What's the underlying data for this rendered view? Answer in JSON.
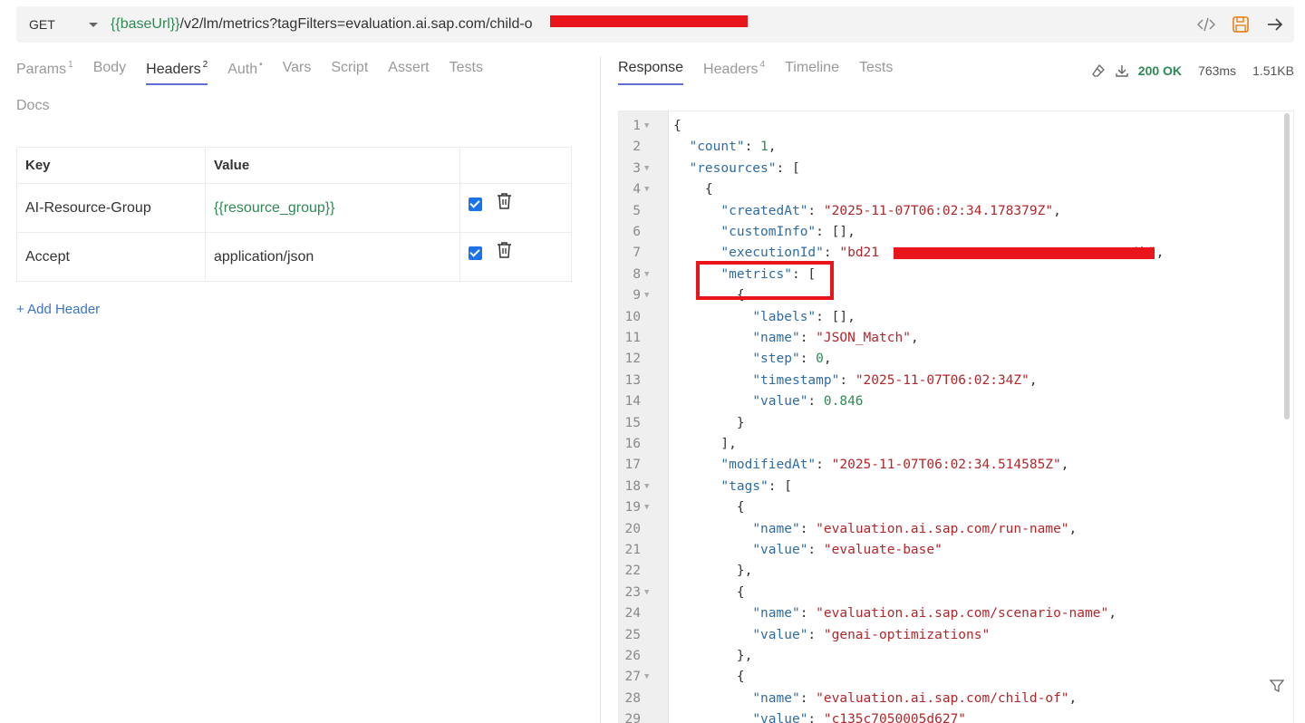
{
  "url_bar": {
    "method": "GET",
    "url_var": "{{baseUrl}}",
    "url_rest": "/v2/lm/metrics?tagFilters=evaluation.ai.sap.com/child-o"
  },
  "request_tabs": [
    {
      "label": "Params",
      "count": "1"
    },
    {
      "label": "Body",
      "count": ""
    },
    {
      "label": "Headers",
      "count": "2"
    },
    {
      "label": "Auth",
      "count": "•"
    },
    {
      "label": "Vars",
      "count": ""
    },
    {
      "label": "Script",
      "count": ""
    },
    {
      "label": "Assert",
      "count": ""
    },
    {
      "label": "Tests",
      "count": ""
    }
  ],
  "docs_tab": "Docs",
  "headers_table": {
    "col_key": "Key",
    "col_value": "Value",
    "rows": [
      {
        "key": "AI-Resource-Group",
        "value": "{{resource_group}}"
      },
      {
        "key": "Accept",
        "value": "application/json"
      }
    ],
    "add_label": "+ Add Header"
  },
  "response_tabs": [
    {
      "label": "Response",
      "count": ""
    },
    {
      "label": "Headers",
      "count": "4"
    },
    {
      "label": "Timeline",
      "count": ""
    },
    {
      "label": "Tests",
      "count": ""
    }
  ],
  "response_meta": {
    "status": "200 OK",
    "time": "763ms",
    "size": "1.51KB"
  },
  "code_lines": [
    {
      "n": "1",
      "fold": true,
      "html": "<span class='p'>{</span>"
    },
    {
      "n": "2",
      "fold": false,
      "html": "  <span class='k'>\"count\"</span><span class='p'>: </span><span class='n'>1</span><span class='p'>,</span>"
    },
    {
      "n": "3",
      "fold": true,
      "html": "  <span class='k'>\"resources\"</span><span class='p'>: [</span>"
    },
    {
      "n": "4",
      "fold": true,
      "html": "    <span class='p'>{</span>"
    },
    {
      "n": "5",
      "fold": false,
      "html": "      <span class='k'>\"createdAt\"</span><span class='p'>: </span><span class='s'>\"2025-11-07T06:02:34.178379Z\"</span><span class='p'>,</span>"
    },
    {
      "n": "6",
      "fold": false,
      "html": "      <span class='k'>\"customInfo\"</span><span class='p'>: [],</span>"
    },
    {
      "n": "7",
      "fold": false,
      "html": "      <span class='k'>\"executionId\"</span><span class='p'>: </span><span class='s'>\"bd21                                0b\"</span><span class='p'>,</span>"
    },
    {
      "n": "8",
      "fold": true,
      "html": "      <span class='k'>\"metrics\"</span><span class='p'>: [</span>"
    },
    {
      "n": "9",
      "fold": true,
      "html": "        <span class='p'>{</span>"
    },
    {
      "n": "10",
      "fold": false,
      "html": "          <span class='k'>\"labels\"</span><span class='p'>: [],</span>"
    },
    {
      "n": "11",
      "fold": false,
      "html": "          <span class='k'>\"name\"</span><span class='p'>: </span><span class='s'>\"JSON_Match\"</span><span class='p'>,</span>"
    },
    {
      "n": "12",
      "fold": false,
      "html": "          <span class='k'>\"step\"</span><span class='p'>: </span><span class='n'>0</span><span class='p'>,</span>"
    },
    {
      "n": "13",
      "fold": false,
      "html": "          <span class='k'>\"timestamp\"</span><span class='p'>: </span><span class='s'>\"2025-11-07T06:02:34Z\"</span><span class='p'>,</span>"
    },
    {
      "n": "14",
      "fold": false,
      "html": "          <span class='k'>\"value\"</span><span class='p'>: </span><span class='n'>0.846</span>"
    },
    {
      "n": "15",
      "fold": false,
      "html": "        <span class='p'>}</span>"
    },
    {
      "n": "16",
      "fold": false,
      "html": "      <span class='p'>],</span>"
    },
    {
      "n": "17",
      "fold": false,
      "html": "      <span class='k'>\"modifiedAt\"</span><span class='p'>: </span><span class='s'>\"2025-11-07T06:02:34.514585Z\"</span><span class='p'>,</span>"
    },
    {
      "n": "18",
      "fold": true,
      "html": "      <span class='k'>\"tags\"</span><span class='p'>: [</span>"
    },
    {
      "n": "19",
      "fold": true,
      "html": "        <span class='p'>{</span>"
    },
    {
      "n": "20",
      "fold": false,
      "html": "          <span class='k'>\"name\"</span><span class='p'>: </span><span class='s'>\"evaluation.ai.sap.com/run-name\"</span><span class='p'>,</span>"
    },
    {
      "n": "21",
      "fold": false,
      "html": "          <span class='k'>\"value\"</span><span class='p'>: </span><span class='s'>\"evaluate-base\"</span>"
    },
    {
      "n": "22",
      "fold": false,
      "html": "        <span class='p'>},</span>"
    },
    {
      "n": "23",
      "fold": true,
      "html": "        <span class='p'>{</span>"
    },
    {
      "n": "24",
      "fold": false,
      "html": "          <span class='k'>\"name\"</span><span class='p'>: </span><span class='s'>\"evaluation.ai.sap.com/scenario-name\"</span><span class='p'>,</span>"
    },
    {
      "n": "25",
      "fold": false,
      "html": "          <span class='k'>\"value\"</span><span class='p'>: </span><span class='s'>\"genai-optimizations\"</span>"
    },
    {
      "n": "26",
      "fold": false,
      "html": "        <span class='p'>},</span>"
    },
    {
      "n": "27",
      "fold": true,
      "html": "        <span class='p'>{</span>"
    },
    {
      "n": "28",
      "fold": false,
      "html": "          <span class='k'>\"name\"</span><span class='p'>: </span><span class='s'>\"evaluation.ai.sap.com/child-of\"</span><span class='p'>,</span>"
    },
    {
      "n": "29",
      "fold": false,
      "html": "          <span class='k'>\"value\"</span><span class='p'>: </span><span class='s'>\"c135c7050005d627\"</span>"
    }
  ],
  "colors": {
    "accent_tab": "#5d6fd6",
    "var_green": "#2d8a53",
    "key_blue": "#2f6ca5",
    "string_red": "#b3262a",
    "redaction": "#e8161b",
    "save_orange": "#e8821b"
  }
}
